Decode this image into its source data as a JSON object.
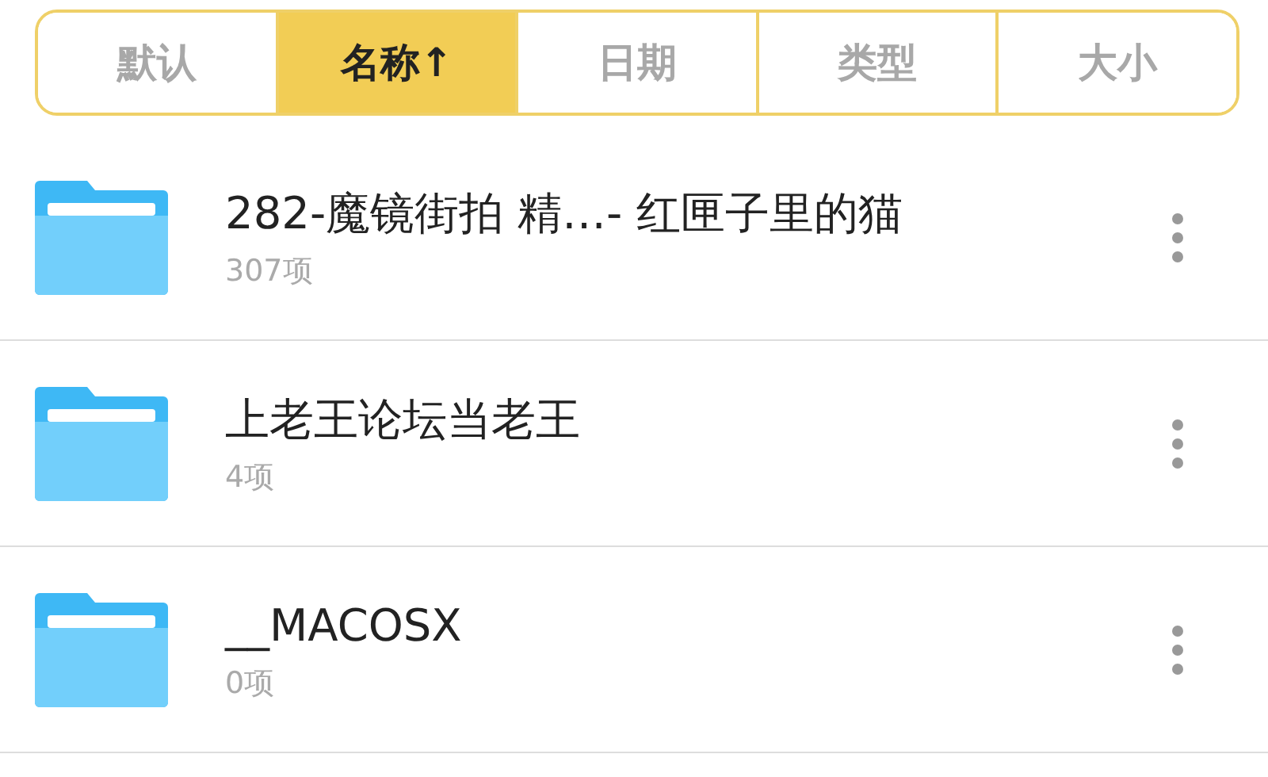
{
  "sort_tabs": [
    {
      "label": "默认",
      "selected": false
    },
    {
      "label": "名称↑",
      "selected": true
    },
    {
      "label": "日期",
      "selected": false
    },
    {
      "label": "类型",
      "selected": false
    },
    {
      "label": "大小",
      "selected": false
    }
  ],
  "files": [
    {
      "name": "282-魔镜街拍 精…- 红匣子里的猫",
      "count": "307项"
    },
    {
      "name": "上老王论坛当老王",
      "count": "4项"
    },
    {
      "name": "__MACOSX",
      "count": "0项"
    }
  ]
}
